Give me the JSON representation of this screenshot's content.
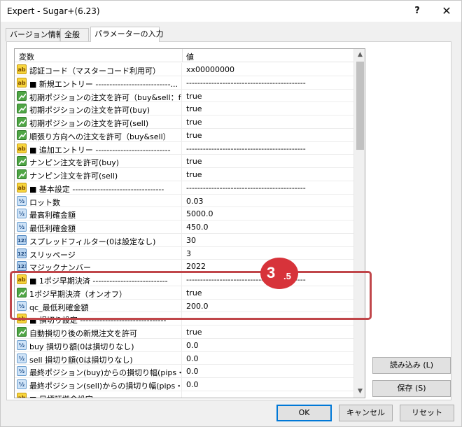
{
  "window": {
    "title": "Expert - Sugar+(6.23)",
    "help_label": "?",
    "close_label": "✕"
  },
  "tabs": [
    "バージョン情報",
    "全般",
    "パラメーターの入力"
  ],
  "table": {
    "col_variable": "変数",
    "col_value": "値",
    "rows": [
      {
        "icon": "ab",
        "name": "認証コード（マスターコード利用可）",
        "value": "xx00000000"
      },
      {
        "icon": "ab",
        "name": "■ 新規エントリー ---------------------------...",
        "value": "-------------------------------------------"
      },
      {
        "icon": "b",
        "name": "初期ポジションの注文を許可（buy&sell：fal...",
        "value": "true"
      },
      {
        "icon": "b",
        "name": "初期ポジションの注文を許可(buy)",
        "value": "true"
      },
      {
        "icon": "b",
        "name": "初期ポジションの注文を許可(sell)",
        "value": "true"
      },
      {
        "icon": "b",
        "name": "順張り方向への注文を許可（buy&sell）",
        "value": "true"
      },
      {
        "icon": "ab",
        "name": "■ 追加エントリー ---------------------------",
        "value": "-------------------------------------------"
      },
      {
        "icon": "b",
        "name": "ナンピン注文を許可(buy)",
        "value": "true"
      },
      {
        "icon": "b",
        "name": "ナンピン注文を許可(sell)",
        "value": "true"
      },
      {
        "icon": "ab",
        "name": "■ 基本設定 ---------------------------------",
        "value": "-------------------------------------------"
      },
      {
        "icon": "d",
        "name": "ロット数",
        "value": "0.03"
      },
      {
        "icon": "d",
        "name": "最高利確金額",
        "value": "5000.0"
      },
      {
        "icon": "d",
        "name": "最低利確金額",
        "value": "450.0"
      },
      {
        "icon": "n",
        "name": "スプレッドフィルター(0は設定なし)",
        "value": "30"
      },
      {
        "icon": "n",
        "name": "スリッページ",
        "value": "3"
      },
      {
        "icon": "n",
        "name": "マジックナンバー",
        "value": "2022"
      },
      {
        "icon": "ab",
        "name": "■ 1ポジ早期決済 ---------------------------",
        "value": "-------------------------------------------"
      },
      {
        "icon": "b",
        "name": "1ポジ早期決済（オンオフ）",
        "value": "true"
      },
      {
        "icon": "d",
        "name": "qc_最低利確金額",
        "value": "200.0"
      },
      {
        "icon": "ab",
        "name": "■ 損切り設定 -------------------------------",
        "value": "-------------------------------------------"
      },
      {
        "icon": "b",
        "name": "自動損切り後の新規注文を許可",
        "value": "true"
      },
      {
        "icon": "d",
        "name": "buy 損切り額(0は損切りなし)",
        "value": "0.0"
      },
      {
        "icon": "d",
        "name": "sell 損切り額(0は損切りなし)",
        "value": "0.0"
      },
      {
        "icon": "d",
        "name": "最終ポジション(buy)からの損切り幅(pips・0は・...",
        "value": "0.0"
      },
      {
        "icon": "d",
        "name": "最終ポジション(sell)からの損切り幅(pips・0は・...",
        "value": "0.0"
      },
      {
        "icon": "ab",
        "name": "■ 目標証拠金設定",
        "value": ""
      }
    ]
  },
  "annotation": {
    "main": "3",
    "sub": ".5",
    "color": "#d7333a"
  },
  "buttons": {
    "load": "読み込み (L)",
    "save": "保存 (S)",
    "ok": "OK",
    "cancel": "キャンセル",
    "reset": "リセット"
  },
  "icons": {
    "ab": "string-type-icon",
    "b": "boolean-type-icon",
    "d": "double-type-icon",
    "n": "integer-type-icon"
  }
}
